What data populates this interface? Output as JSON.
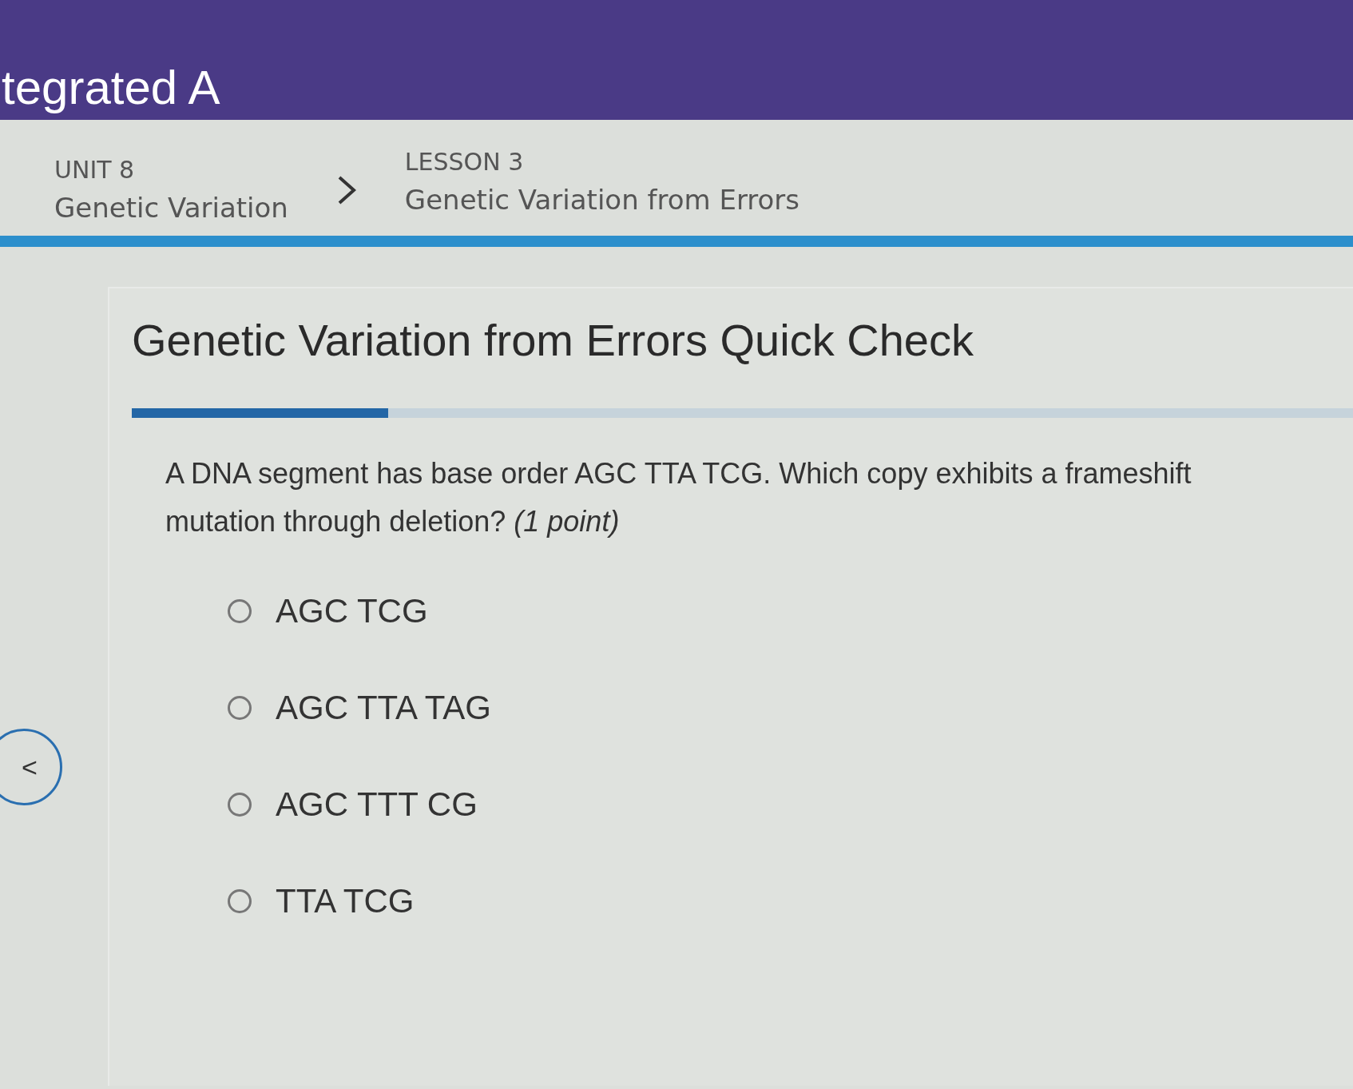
{
  "header": {
    "title": "tegrated A"
  },
  "breadcrumb": {
    "unit_label": "UNIT 8",
    "unit_name": "Genetic Variation",
    "lesson_label": "LESSON 3",
    "lesson_name": "Genetic Variation from Errors"
  },
  "quiz": {
    "title": "Genetic Variation from Errors Quick Check",
    "progress": {
      "level": 0.21
    },
    "question": "A DNA segment has base order AGC TTA TCG. Which copy exhibits a frameshift mutation through deletion?  *(1 point)*",
    "options": [
      {
        "label": "AGC TCG",
        "selected": false
      },
      {
        "label": "AGC TTA TAG",
        "selected": false
      },
      {
        "label": "AGC TTT CG",
        "selected": false
      },
      {
        "label": "TTA TCG",
        "selected": false
      }
    ]
  },
  "back_button": {
    "label": "<"
  }
}
